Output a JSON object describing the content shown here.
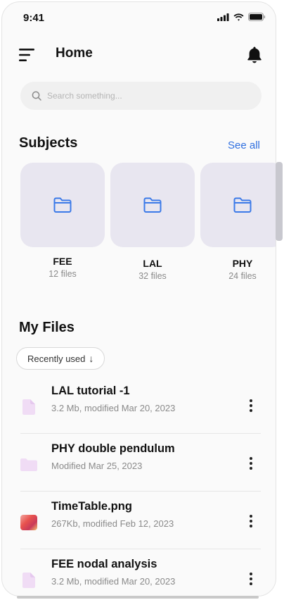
{
  "status": {
    "time": "9:41"
  },
  "header": {
    "title": "Home"
  },
  "search": {
    "placeholder": "Search something..."
  },
  "subjects": {
    "title": "Subjects",
    "see_all": "See all",
    "items": [
      {
        "name": "FEE",
        "count": "12 files"
      },
      {
        "name": "LAL",
        "count": "32 files"
      },
      {
        "name": "PHY",
        "count": "24 files"
      }
    ]
  },
  "my_files": {
    "title": "My Files",
    "filter_label": "Recently used",
    "filter_arrow": "↓",
    "items": [
      {
        "name": "LAL tutorial -1",
        "meta": "3.2 Mb, modified Mar 20, 2023",
        "icon": "file-icon"
      },
      {
        "name": "PHY double pendulum",
        "meta": "Modified Mar 25, 2023",
        "icon": "folder-icon"
      },
      {
        "name": "TimeTable.png",
        "meta": "267Kb, modified Feb 12, 2023",
        "icon": "image-thumbnail"
      },
      {
        "name": "FEE nodal analysis",
        "meta": "3.2 Mb, modified Mar 20, 2023",
        "icon": "file-icon"
      }
    ]
  },
  "colors": {
    "accent": "#2f6fe0",
    "tile": "#e8e6f0",
    "file_icon": "#f0dcf5"
  }
}
